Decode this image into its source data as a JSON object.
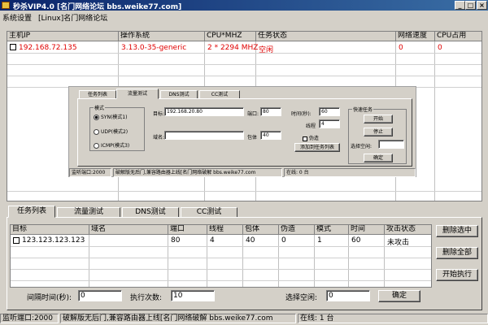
{
  "window": {
    "title": "秒杀VIP4.0 [名门网络论坛 bbs.weike77.com]",
    "minimize": "_",
    "maximize": "□",
    "close": "×"
  },
  "menu": [
    "系统设置",
    "[Linux]名门网络论坛"
  ],
  "hosts": {
    "columns": [
      "主机IP",
      "操作系统",
      "CPU*MHZ",
      "任务状态",
      "网络速度",
      "CPU占用"
    ],
    "rows": [
      {
        "ip": "192.168.72.135",
        "os": "3.13.0-35-generic",
        "cpu": "2 * 2294 MHZ",
        "status": "空闲",
        "speed": "0",
        "usage": "0"
      }
    ]
  },
  "overlay": {
    "tabs": [
      "任务列表",
      "流量测试",
      "DNS测试",
      "CC测试"
    ],
    "mode_title": "模式",
    "modes": [
      "SYN(模式1)",
      "UDP(模式2)",
      "ICMP(模式3)"
    ],
    "target_label": "目标:",
    "target_value": "192.168.20.80",
    "port_label": "端口:",
    "port_value": "80",
    "domain_label": "域名:",
    "packet_label": "包体",
    "packet_value": "40",
    "time_label": "时间(秒):",
    "time_value": "60",
    "thread_label": "线程",
    "thread_value": "4",
    "fake_label": "伪造",
    "add_button": "添加到任务列表",
    "quick_title": "快速任务",
    "start_button": "开始",
    "stop_button": "停止",
    "select_label": "选择空闲:",
    "confirm_button": "确定",
    "status_port": "监听端口:2000",
    "status_text": "破解版无后门,兼容路由器上线[名门网络破解 bbs.weike77.com",
    "status_online": "在线: 0 台"
  },
  "tabs": [
    "任务列表",
    "流量测试",
    "DNS测试",
    "CC测试"
  ],
  "tasks": {
    "columns": [
      "目标",
      "域名",
      "端口",
      "线程",
      "包体",
      "伪造",
      "模式",
      "时间",
      "攻击状态"
    ],
    "rows": [
      {
        "target": "123.123.123.123",
        "domain": "",
        "port": "80",
        "thread": "4",
        "packet": "40",
        "fake": "0",
        "mode": "1",
        "time": "60",
        "status": "未攻击"
      }
    ]
  },
  "side_buttons": [
    "删除选中",
    "删除全部",
    "开始执行"
  ],
  "controls": {
    "interval_label": "间隔时间(秒):",
    "interval_value": "0",
    "count_label": "执行次数:",
    "count_value": "10",
    "select_label": "选择空闲:",
    "select_value": "0",
    "confirm_button": "确定"
  },
  "status": {
    "port": "监听端口:2000",
    "text": "破解版无后门,兼容路由器上线[名门网络破解 bbs.weike77.com",
    "online": "在线: 1 台"
  }
}
